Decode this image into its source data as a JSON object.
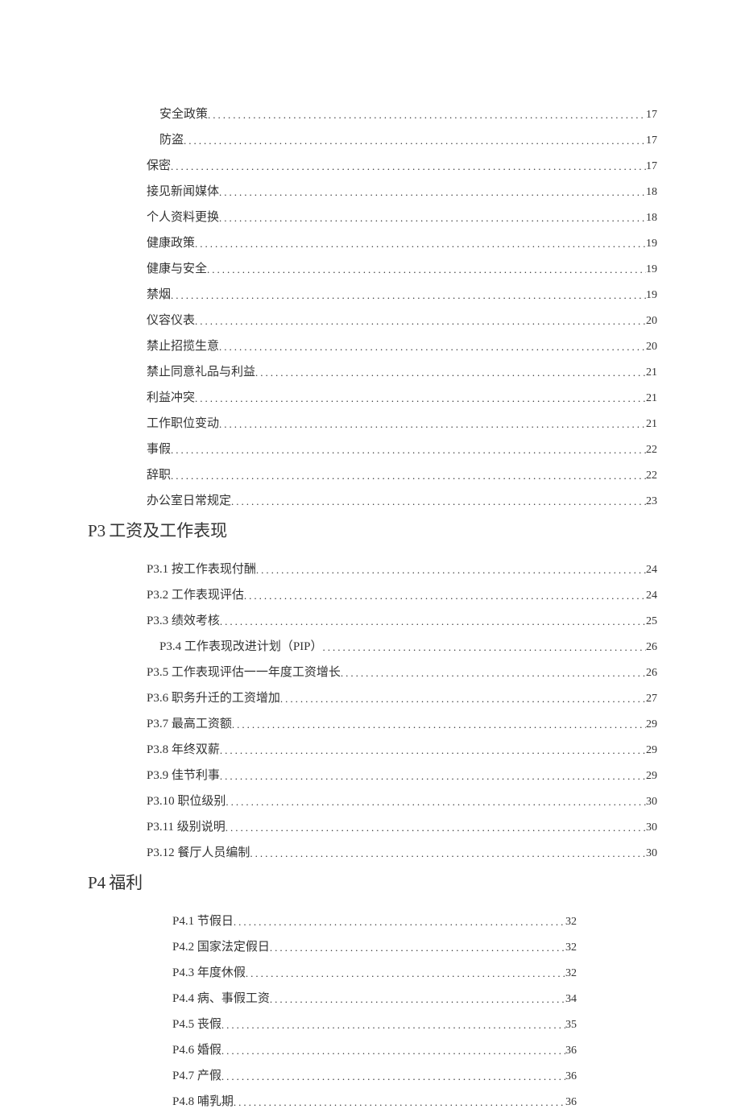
{
  "section_p2_rest": [
    {
      "label": "安全政策",
      "page": "17",
      "indent": "indent-1"
    },
    {
      "label": "防盗",
      "page": "17",
      "indent": "indent-1"
    },
    {
      "label": "保密",
      "page": "17",
      "indent": "indent-2"
    },
    {
      "label": "接见新闻媒体",
      "page": "18",
      "indent": "indent-2"
    },
    {
      "label": "个人资料更换",
      "page": "18",
      "indent": "indent-2"
    },
    {
      "label": "健康政策",
      "page": "19",
      "indent": "indent-2"
    },
    {
      "label": "健康与安全",
      "page": "19",
      "indent": "indent-2"
    },
    {
      "label": "禁烟",
      "page": "19",
      "indent": "indent-2"
    },
    {
      "label": "仪容仪表",
      "page": "20",
      "indent": "indent-2"
    },
    {
      "label": "禁止招揽生意",
      "page": "20",
      "indent": "indent-2"
    },
    {
      "label": "禁止同意礼品与利益",
      "page": "21",
      "indent": "indent-2"
    },
    {
      "label": "利益冲突",
      "page": "21",
      "indent": "indent-2"
    },
    {
      "label": "工作职位变动",
      "page": "21",
      "indent": "indent-2"
    },
    {
      "label": "事假",
      "page": "22",
      "indent": "indent-2"
    },
    {
      "label": "辞职",
      "page": "22",
      "indent": "indent-2"
    },
    {
      "label": "办公室日常规定",
      "page": "23",
      "indent": "indent-2"
    }
  ],
  "p3_heading_prefix": "P3",
  "p3_heading_text": "工资及工作表现",
  "section_p3": [
    {
      "label": "P3.1 按工作表现付酬",
      "page": "24",
      "indent": "indent-3"
    },
    {
      "label": "P3.2 工作表现评估",
      "page": "24",
      "indent": "indent-3"
    },
    {
      "label": "P3.3 绩效考核",
      "page": "25",
      "indent": "indent-3"
    },
    {
      "label": "P3.4 工作表现改进计划（PIP）",
      "page": "26",
      "indent": "indent-3b"
    },
    {
      "label": "P3.5 工作表现评估一一年度工资增长",
      "page": "26",
      "indent": "indent-3"
    },
    {
      "label": "P3.6 职务升迁的工资增加",
      "page": "27",
      "indent": "indent-3"
    },
    {
      "label": "P3.7 最高工资额",
      "page": "29",
      "indent": "indent-3"
    },
    {
      "label": "P3.8 年终双薪",
      "page": "29",
      "indent": "indent-3"
    },
    {
      "label": "P3.9 佳节利事",
      "page": "29",
      "indent": "indent-3"
    },
    {
      "label": "P3.10 职位级别",
      "page": "30",
      "indent": "indent-3"
    },
    {
      "label": "P3.11 级别说明",
      "page": "30",
      "indent": "indent-3"
    },
    {
      "label": "P3.12 餐厅人员编制",
      "page": "30",
      "indent": "indent-3"
    }
  ],
  "p4_heading_prefix": "P4",
  "p4_heading_text": "福利",
  "section_p4": [
    {
      "label": "P4.1 节假日",
      "page": "32",
      "indent": "indent-4"
    },
    {
      "label": "P4.2 国家法定假日",
      "page": "32",
      "indent": "indent-4"
    },
    {
      "label": "P4.3 年度休假",
      "page": "32",
      "indent": "indent-4"
    },
    {
      "label": "P4.4 病、事假工资",
      "page": "34",
      "indent": "indent-4"
    },
    {
      "label": "P4.5  丧假",
      "page": "35",
      "indent": "indent-4"
    },
    {
      "label": "P4.6  婚假",
      "page": "36",
      "indent": "indent-4"
    },
    {
      "label": "P4.7  产假",
      "page": "36",
      "indent": "indent-4"
    },
    {
      "label": "P4.8 哺乳期",
      "page": "36",
      "indent": "indent-4"
    }
  ]
}
